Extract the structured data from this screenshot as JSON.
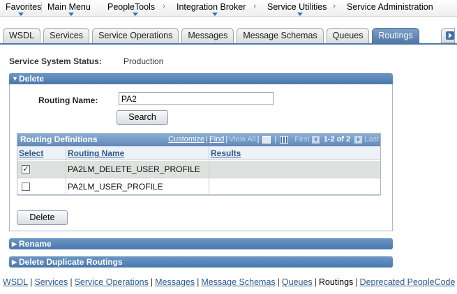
{
  "menubar": {
    "items": [
      {
        "label": "Favorites"
      },
      {
        "label": "Main Menu"
      },
      {
        "label": "PeopleTools"
      },
      {
        "label": "Integration Broker"
      },
      {
        "label": "Service Utilities"
      },
      {
        "label": "Service Administration"
      }
    ]
  },
  "tabs": [
    {
      "label": "WSDL",
      "active": false
    },
    {
      "label": "Services",
      "active": false
    },
    {
      "label": "Service Operations",
      "active": false
    },
    {
      "label": "Messages",
      "active": false
    },
    {
      "label": "Message Schemas",
      "active": false
    },
    {
      "label": "Queues",
      "active": false
    },
    {
      "label": "Routings",
      "active": true
    }
  ],
  "status": {
    "label": "Service System Status:",
    "value": "Production"
  },
  "delete_section": {
    "title": "Delete",
    "routing_label": "Routing Name:",
    "routing_value": "PA2",
    "search_button": "Search",
    "delete_button": "Delete"
  },
  "grid": {
    "title": "Routing Definitions",
    "customize": "Customize",
    "find": "Find",
    "view_all": "View All",
    "first": "First",
    "range": "1-2 of 2",
    "last": "Last",
    "columns": {
      "select": "Select",
      "routing_name": "Routing Name",
      "results": "Results"
    },
    "rows": [
      {
        "checked": true,
        "check_glyph": "✓",
        "routing_name": "PA2LM_DELETE_USER_PROFILE",
        "results": ""
      },
      {
        "checked": false,
        "check_glyph": "",
        "routing_name": "PA2LM_USER_PROFILE",
        "results": ""
      }
    ]
  },
  "sections": {
    "rename": "Rename",
    "delete_duplicates": "Delete Duplicate Routings"
  },
  "footer": {
    "links": [
      "WSDL",
      "Services",
      "Service Operations",
      "Messages",
      "Message Schemas",
      "Queues"
    ],
    "current": "Routings",
    "last_link": "Deprecated PeopleCode",
    "separator": "|"
  },
  "colors": {
    "header_blue": "#4a78ad",
    "link_blue": "#2d5a8e",
    "selected_row": "#dfe1df"
  }
}
